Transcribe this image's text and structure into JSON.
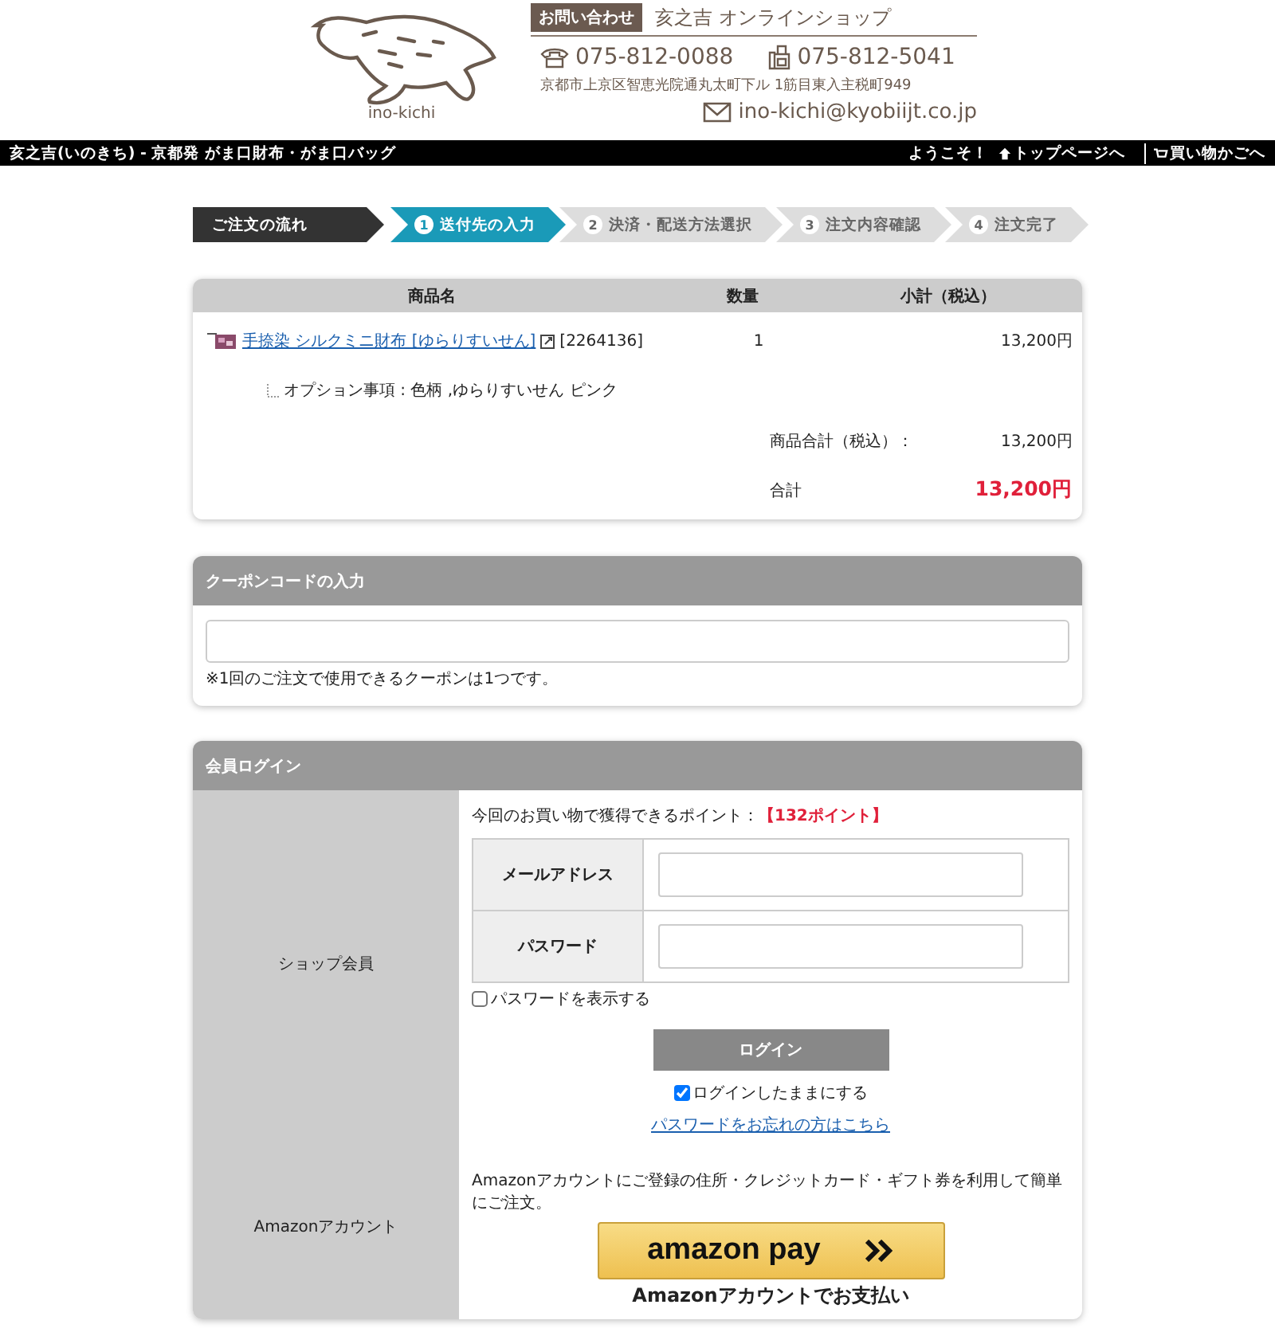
{
  "header": {
    "logo_text": "ino-kichi",
    "contact_badge": "お問い合わせ",
    "shop_name": "亥之吉 オンラインショップ",
    "phone": "075-812-0088",
    "fax": "075-812-5041",
    "address": "京都市上京区智恵光院通丸太町下ル 1筋目東入主税町949",
    "email": "ino-kichi@kyobiijt.co.jp"
  },
  "top_bar": {
    "site_title": "亥之吉(いのきち) - 京都発 がま口財布・がま口バッグ",
    "welcome": "ようこそ！",
    "links": [
      {
        "kind": "home",
        "label": "トップページへ"
      },
      {
        "kind": "cart",
        "label": "買い物かごへ"
      }
    ]
  },
  "steps": [
    {
      "kind": "title",
      "label": "ご注文の流れ"
    },
    {
      "kind": "step",
      "number": "1",
      "label": "送付先の入力",
      "selected": true
    },
    {
      "kind": "step",
      "number": "2",
      "label": "決済・配送方法選択",
      "selected": false
    },
    {
      "kind": "step",
      "number": "3",
      "label": "注文内容確認",
      "selected": false
    },
    {
      "kind": "step",
      "number": "4",
      "label": "注文完了",
      "selected": false
    }
  ],
  "cart": {
    "columns": [
      "商品名",
      "数量",
      "小計（税込）"
    ],
    "items": [
      {
        "name": "手捺染 シルクミニ財布 [ゆらりすいせん]",
        "code": "[2264136]",
        "quantity": "1",
        "subtotal": "13,200円",
        "option": "オプション事項 : 色柄 ,ゆらりすいせん ピンク"
      }
    ],
    "goods_total_label": "商品合計（税込）：",
    "goods_total": "13,200円",
    "total_label": "合計",
    "total": "13,200円"
  },
  "coupon": {
    "title": "クーポンコードの入力",
    "note": "※1回のご注文で使用できるクーポンは1つです。"
  },
  "login": {
    "title": "会員ログイン",
    "member_label": "ショップ会員",
    "points": "今回のお買い物で獲得できるポイント：**【132ポイント】**",
    "fields": [
      {
        "label": "メールアドレス"
      },
      {
        "label": "パスワード"
      }
    ],
    "show_password": {
      "label": "パスワードを表示する",
      "checked": false
    },
    "login_button": "ログイン",
    "stay_logged_in": {
      "label": "ログインしたままにする",
      "checked": true
    },
    "forgot_link": "パスワードをお忘れの方はこちら",
    "amazon_label": "Amazonアカウント",
    "amazon_text": "Amazonアカウントにご登録の住所・クレジットカード・ギフト券を利用して簡単にご注文。",
    "amazon_logo": "amazon pay",
    "amazon_caption": "Amazonアカウントでお支払い"
  }
}
